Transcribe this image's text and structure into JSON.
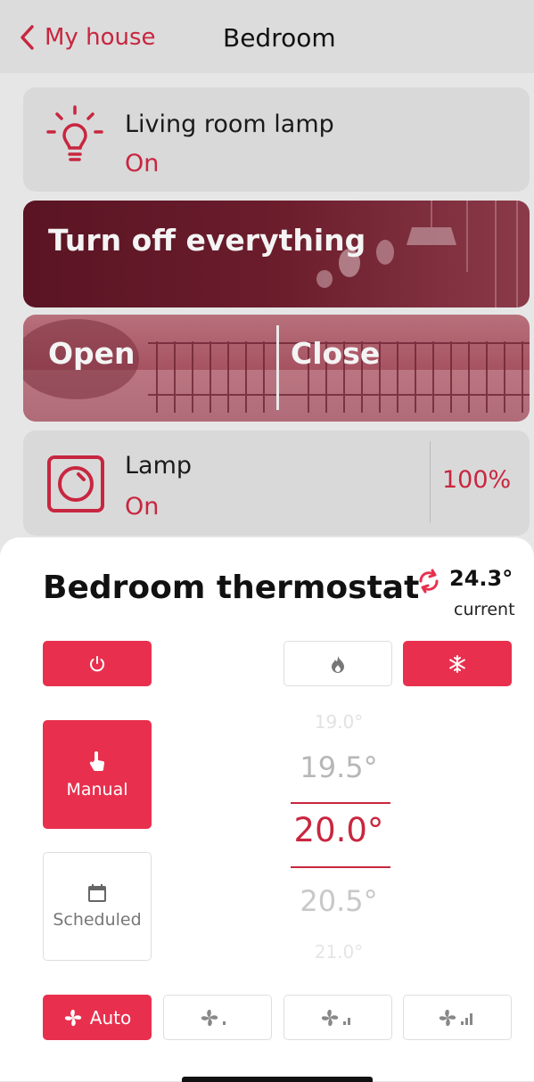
{
  "header": {
    "back_label": "My house",
    "title": "Bedroom"
  },
  "devices": [
    {
      "name": "Living room lamp",
      "state": "On",
      "icon": "lightbulb-icon"
    },
    {
      "name": "Lamp",
      "state": "On",
      "level": "100%",
      "icon": "dimmer-switch-icon"
    }
  ],
  "scenes": {
    "turn_off": "Turn off everything",
    "gate_open": "Open",
    "gate_close": "Close"
  },
  "thermostat": {
    "title": "Bedroom thermostat",
    "current_temp": "24.3°",
    "current_label": "current",
    "modes": {
      "manual": "Manual",
      "scheduled": "Scheduled"
    },
    "setpoints": [
      "19.0°",
      "19.5°",
      "20.0°",
      "20.5°",
      "21.0°"
    ],
    "selected_setpoint": "20.0°",
    "fan": {
      "auto_label": "Auto",
      "selected": "Auto"
    },
    "accent_color": "#e8304e"
  }
}
